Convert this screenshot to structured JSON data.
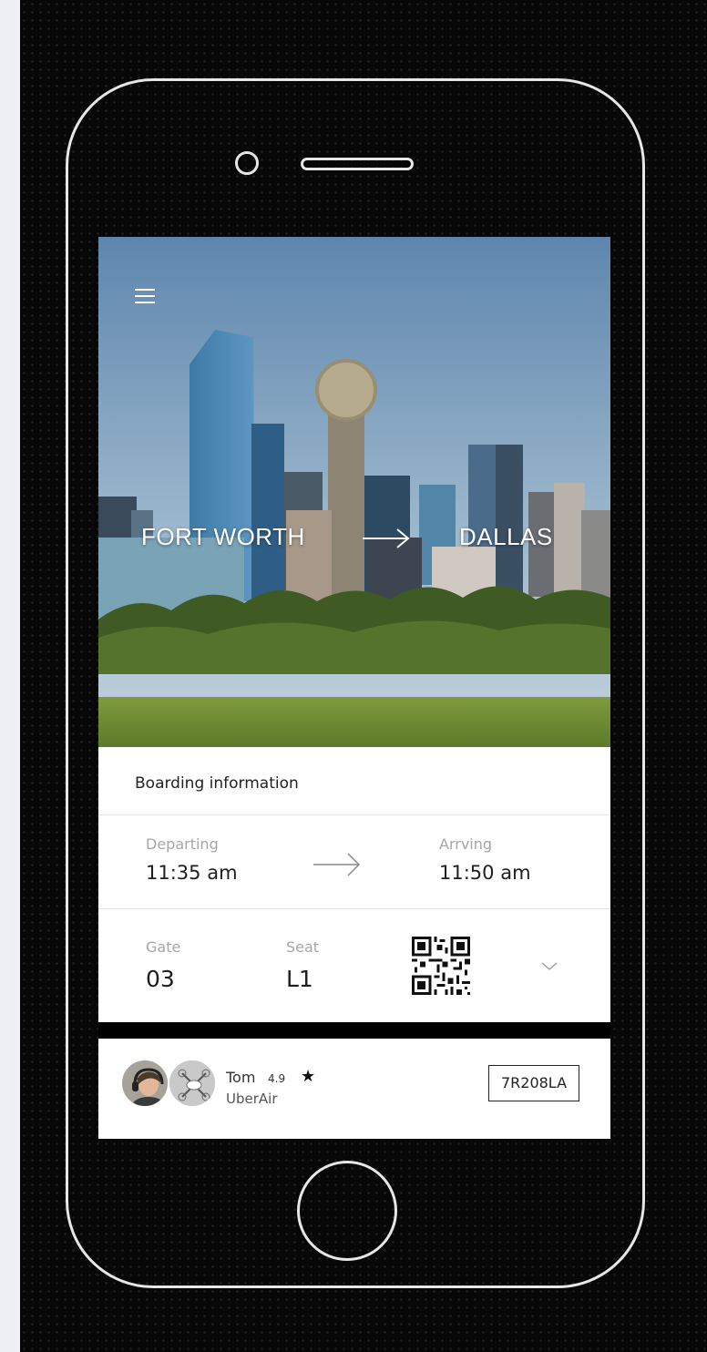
{
  "route": {
    "origin": "FORT WORTH",
    "destination": "DALLAS"
  },
  "boarding": {
    "title": "Boarding information",
    "departing_label": "Departing",
    "departing_time": "11:35 am",
    "arriving_label": "Arrving",
    "arriving_time": "11:50 am",
    "gate_label": "Gate",
    "gate_value": "03",
    "seat_label": "Seat",
    "seat_value": "L1"
  },
  "pilot": {
    "name": "Tom",
    "rating": "4.9",
    "rating_icon": "★",
    "service": "UberAir",
    "tail_number": "7R208LA"
  },
  "icons": {
    "menu": "hamburger-menu-icon",
    "arrow": "arrow-right-icon",
    "qr": "qr-code-icon",
    "chevron": "chevron-down-icon",
    "star": "star-icon"
  },
  "colors": {
    "background": "#070707",
    "outline": "#e6e6e6",
    "text_primary": "#1e1e1e",
    "text_muted": "#a6a6a6"
  }
}
